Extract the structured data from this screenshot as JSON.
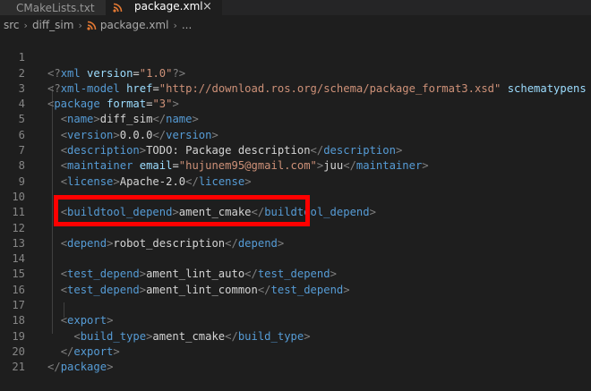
{
  "tabs": {
    "inactive_label": "CMakeLists.txt",
    "active_label": "package.xml",
    "active_icon": "rss-icon",
    "close_glyph": "×"
  },
  "breadcrumb": {
    "items": [
      "src",
      "diff_sim",
      "package.xml",
      "..."
    ],
    "separator": "›"
  },
  "colors": {
    "background": "#1e1e1e",
    "tag": "#569cd6",
    "attribute": "#9cdcfe",
    "string": "#ce9178",
    "text": "#d4d4d4",
    "highlight": "#ff0000",
    "rss": "#e37933"
  },
  "code": {
    "line_numbers": [
      "1",
      "2",
      "3",
      "4",
      "5",
      "6",
      "7",
      "8",
      "9",
      "10",
      "11",
      "12",
      "13",
      "14",
      "15",
      "16",
      "17",
      "18",
      "19",
      "20",
      "21"
    ],
    "line1": {
      "open": "<?",
      "tag": "xml",
      "attr": "version",
      "eq": "=",
      "val": "\"1.0\"",
      "close": "?>"
    },
    "line2": {
      "open": "<?",
      "tag": "xml-model",
      "attr1": "href",
      "eq": "=",
      "val1": "\"http://download.ros.org/schema/package_format3.xsd\"",
      "attr2": "schematypens"
    },
    "line3": {
      "tag": "package",
      "attr": "format",
      "eq": "=",
      "val": "\"3\""
    },
    "line4": {
      "tag": "name",
      "text": "diff_sim"
    },
    "line5": {
      "tag": "version",
      "text": "0.0.0"
    },
    "line6": {
      "tag": "description",
      "text": "TODO: Package description"
    },
    "line7": {
      "tag": "maintainer",
      "attr": "email",
      "eq": "=",
      "val": "\"hujunem95@gmail.com\"",
      "text": "juu"
    },
    "line8": {
      "tag": "license",
      "text": "Apache-2.0"
    },
    "line10": {
      "tag": "buildtool_depend",
      "text": "ament_cmake"
    },
    "line12": {
      "tag": "depend",
      "text": "robot_description"
    },
    "line14": {
      "tag": "test_depend",
      "text": "ament_lint_auto"
    },
    "line15": {
      "tag": "test_depend",
      "text": "ament_lint_common"
    },
    "line17": {
      "tag": "export"
    },
    "line18": {
      "tag": "build_type",
      "text": "ament_cmake"
    },
    "line19": {
      "tag": "export"
    },
    "line20": {
      "tag": "package"
    }
  }
}
